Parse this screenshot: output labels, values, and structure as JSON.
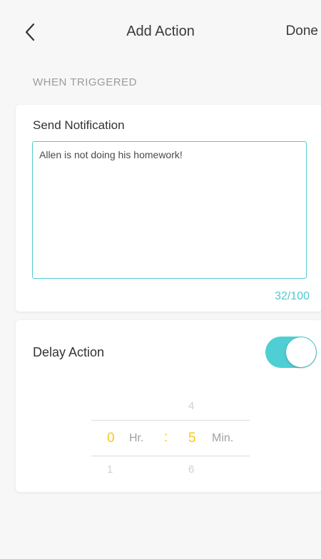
{
  "header": {
    "title": "Add Action",
    "done_label": "Done",
    "back_icon": "chevron-left-icon"
  },
  "section": {
    "label": "WHEN TRIGGERED"
  },
  "notification": {
    "title": "Send Notification",
    "message": "Allen is not doing his homework!",
    "char_count": "32/100"
  },
  "delay": {
    "title": "Delay Action",
    "enabled": true,
    "picker": {
      "hours_value": "0",
      "hours_unit": "Hr.",
      "separator": ":",
      "minutes_value": "5",
      "minutes_unit": "Min.",
      "minutes_prev": "4",
      "hours_next": "1",
      "minutes_next": "6"
    }
  },
  "colors": {
    "accent": "#4fc9d0",
    "picker_value": "#f8c91a",
    "background": "#f7f7f8"
  }
}
